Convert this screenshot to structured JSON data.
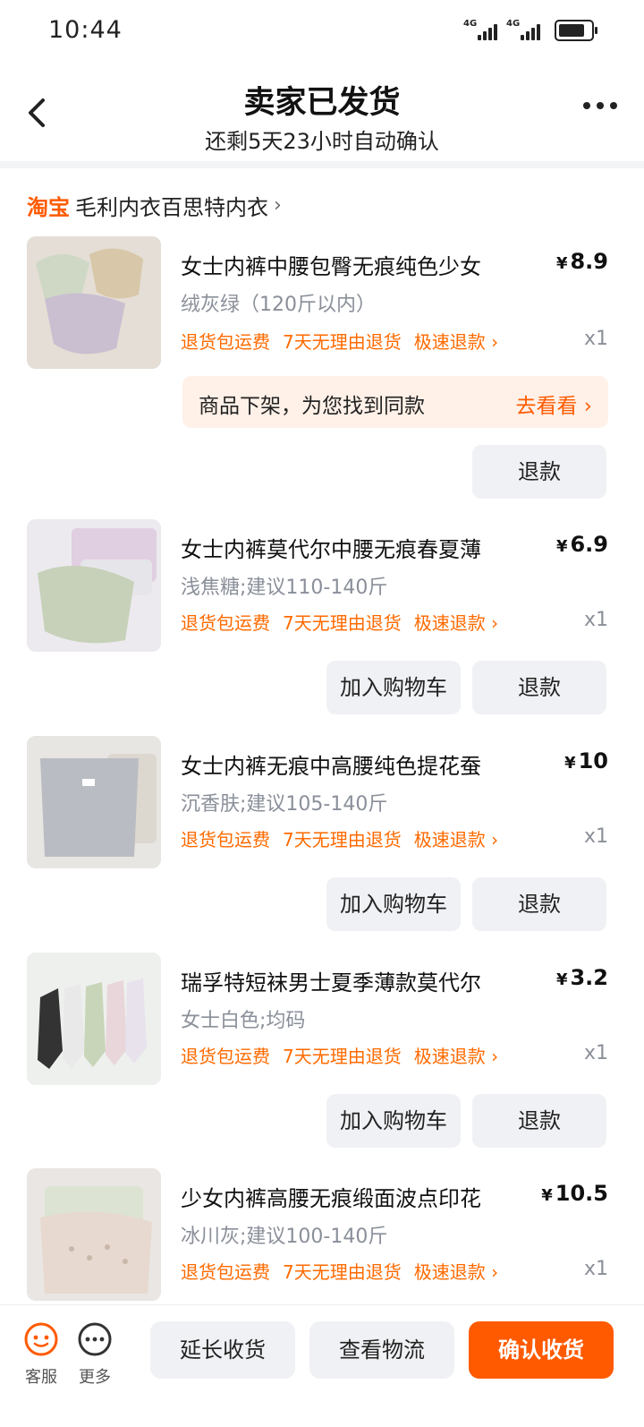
{
  "status_bar": {
    "time": "10:44",
    "signal_1": "4G",
    "signal_2": "4G"
  },
  "header": {
    "title": "卖家已发货",
    "subtitle": "还剩5天23小时自动确认"
  },
  "shop": {
    "brand": "淘宝",
    "name": "毛利内衣百思特内衣"
  },
  "tags": [
    "退货包运费",
    "7天无理由退货",
    "极速退款 ›"
  ],
  "items": [
    {
      "title": "女士内裤中腰包臀无痕纯色少女",
      "price": "8.9",
      "currency": "¥",
      "spec": "绒灰绿（120斤以内）",
      "qty": "x1",
      "notice": "商品下架，为您找到同款",
      "notice_action": "去看看 ›",
      "refund": "退款"
    },
    {
      "title": "女士内裤莫代尔中腰无痕春夏薄",
      "price": "6.9",
      "currency": "¥",
      "spec": "浅焦糖;建议110-140斤",
      "qty": "x1",
      "cart": "加入购物车",
      "refund": "退款"
    },
    {
      "title": "女士内裤无痕中高腰纯色提花蚕",
      "price": "10",
      "currency": "¥",
      "spec": "沉香肤;建议105-140斤",
      "qty": "x1",
      "cart": "加入购物车",
      "refund": "退款"
    },
    {
      "title": "瑞孚特短袜男士夏季薄款莫代尔",
      "price": "3.2",
      "currency": "¥",
      "spec": "女士白色;均码",
      "qty": "x1",
      "cart": "加入购物车",
      "refund": "退款"
    },
    {
      "title": "少女内裤高腰无痕缎面波点印花",
      "price": "10.5",
      "currency": "¥",
      "spec": "冰川灰;建议100-140斤",
      "qty": "x1"
    }
  ],
  "bottom_bar": {
    "service_label": "客服",
    "more_label": "更多",
    "extend": "延长收货",
    "logistics": "查看物流",
    "confirm": "确认收货"
  },
  "colors": {
    "accent": "#ff5a00",
    "tag": "#ff6a00",
    "button_gray": "#f0f1f4",
    "notice_bg": "#fff1e8"
  }
}
